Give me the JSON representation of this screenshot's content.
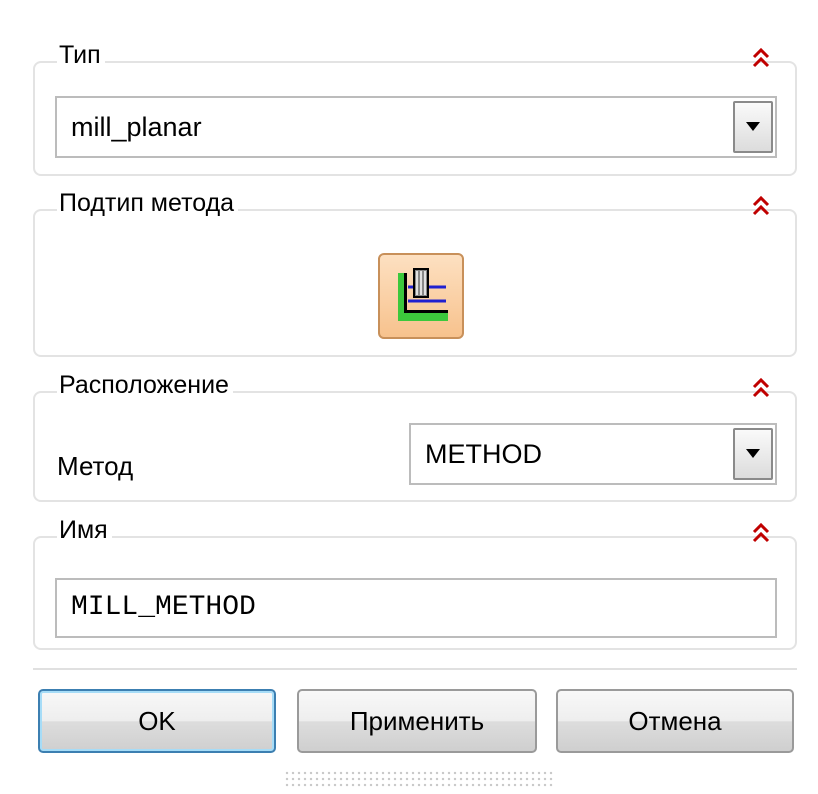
{
  "sections": {
    "type": {
      "title": "Тип",
      "value": "mill_planar",
      "collapse_icon": "double-chevron-up-icon"
    },
    "subtype": {
      "title": "Подтип метода",
      "icon": "mill-planar-method-icon",
      "collapse_icon": "double-chevron-up-icon"
    },
    "location": {
      "title": "Расположение",
      "method_label": "Метод",
      "method_value": "METHOD",
      "collapse_icon": "double-chevron-up-icon"
    },
    "name": {
      "title": "Имя",
      "value": "MILL_METHOD",
      "collapse_icon": "double-chevron-up-icon"
    }
  },
  "buttons": {
    "ok": "OK",
    "apply": "Применить",
    "cancel": "Отмена"
  },
  "colors": {
    "collapse_icon": "#c00000",
    "subtype_button": "#f7c28d",
    "default_button_border": "#3c7fb1"
  }
}
